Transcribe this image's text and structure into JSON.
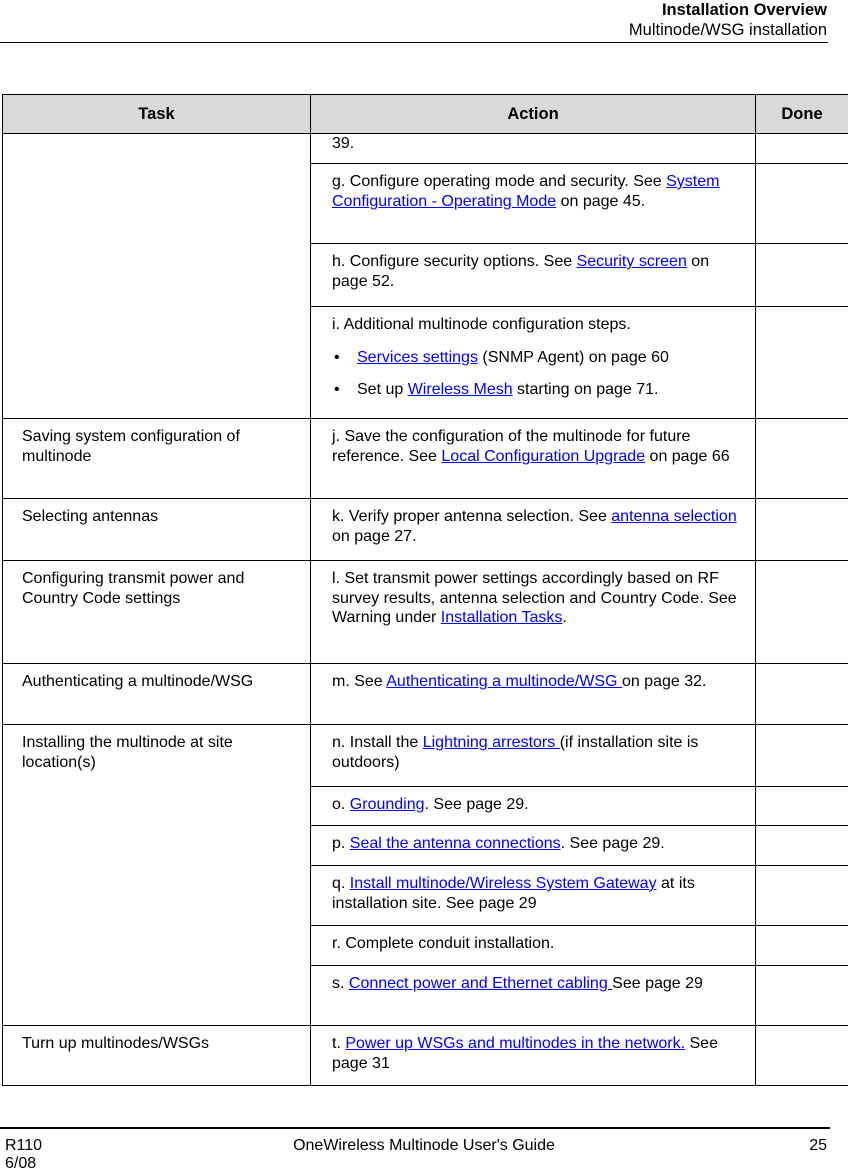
{
  "header": {
    "title": "Installation Overview",
    "subtitle": "Multinode/WSG installation"
  },
  "table": {
    "columns": [
      "Task",
      "Action",
      "Done"
    ],
    "rows": [
      {
        "task": "",
        "actions": [
          {
            "parts": [
              {
                "text": "39."
              }
            ]
          },
          {
            "parts": [
              {
                "text": "g. Configure operating mode and security.  See "
              },
              {
                "link": "System Configuration - Operating Mode"
              },
              {
                "text": " on page 45."
              }
            ]
          },
          {
            "parts": [
              {
                "text": "h. Configure security options.  See "
              },
              {
                "link": "Security screen"
              },
              {
                "text": " on page 52."
              }
            ]
          },
          {
            "parts": [
              {
                "text": "i. Additional multinode configuration steps."
              }
            ],
            "bullets": [
              [
                {
                  "link": "Services settings"
                },
                {
                  "text": " (SNMP Agent) on page 60"
                }
              ],
              [
                {
                  "text": "Set up "
                },
                {
                  "link": "Wireless Mesh"
                },
                {
                  "text": " starting on page 71."
                }
              ]
            ]
          }
        ]
      },
      {
        "task": "Saving system configuration of multinode",
        "actions": [
          {
            "parts": [
              {
                "text": "j. Save the configuration of the multinode for future reference.  See "
              },
              {
                "link": "Local Configuration Upgrade"
              },
              {
                "text": " on page 66"
              }
            ]
          }
        ]
      },
      {
        "task": "Selecting antennas",
        "actions": [
          {
            "parts": [
              {
                "text": "k. Verify proper antenna selection.  See "
              },
              {
                "link": "antenna selection"
              },
              {
                "text": " on page 27."
              }
            ]
          }
        ]
      },
      {
        "task": "Configuring transmit power and Country Code settings",
        "actions": [
          {
            "parts": [
              {
                "text": "l. Set transmit power settings accordingly based on RF survey results, antenna selection and Country Code.  See Warning under "
              },
              {
                "link": "Installation Tasks"
              },
              {
                "text": "."
              }
            ]
          }
        ]
      },
      {
        "task": "Authenticating a multinode/WSG",
        "actions": [
          {
            "parts": [
              {
                "text": "m. See "
              },
              {
                "link": "Authenticating a multinode/WSG "
              },
              {
                "text": "on page 32."
              }
            ]
          }
        ]
      },
      {
        "task": "Installing the multinode at site location(s)",
        "actions": [
          {
            "parts": [
              {
                "text": "n. Install the "
              },
              {
                "link": "Lightning arrestors "
              },
              {
                "text": "(if installation site is outdoors)"
              }
            ]
          },
          {
            "parts": [
              {
                "text": "o. "
              },
              {
                "link": "Grounding"
              },
              {
                "text": ".  See page 29."
              }
            ]
          },
          {
            "parts": [
              {
                "text": "p. "
              },
              {
                "link": "Seal the antenna connections"
              },
              {
                "text": ".  See page 29."
              }
            ]
          },
          {
            "parts": [
              {
                "text": "q. "
              },
              {
                "link": "Install multinode/Wireless System Gateway"
              },
              {
                "text": " at its installation site.  See page 29"
              }
            ]
          },
          {
            "parts": [
              {
                "text": "r. Complete conduit installation."
              }
            ]
          },
          {
            "parts": [
              {
                "text": "s. "
              },
              {
                "link": "Connect power and Ethernet cabling "
              },
              {
                "text": " See page 29"
              }
            ]
          }
        ]
      },
      {
        "task": "Turn up multinodes/WSGs",
        "actions": [
          {
            "parts": [
              {
                "text": "t. "
              },
              {
                "link": "Power up WSGs and multinodes in the network."
              },
              {
                "text": "  See page 31"
              }
            ]
          }
        ]
      }
    ]
  },
  "footer": {
    "release": "R110",
    "date": "6/08",
    "guide_title": "OneWireless Multinode User's Guide",
    "page_number": "25"
  },
  "colors": {
    "link": "#0000ff",
    "header_bg": "#d9d9d9",
    "text": "#000000"
  }
}
